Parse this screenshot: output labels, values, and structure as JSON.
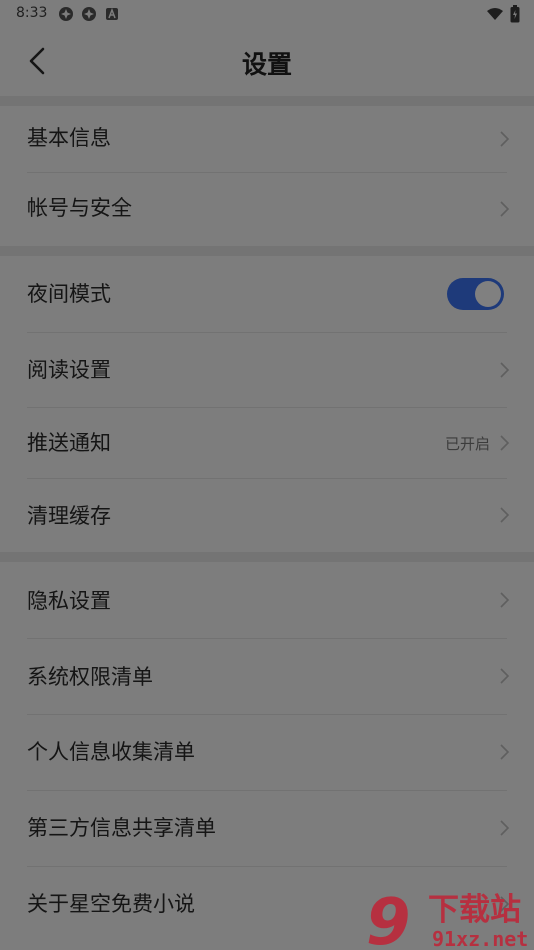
{
  "status": {
    "time": "8:33"
  },
  "header": {
    "title": "设置"
  },
  "group1": [
    {
      "label": "基本信息"
    },
    {
      "label": "帐号与安全"
    }
  ],
  "group2": {
    "night_mode": {
      "label": "夜间模式",
      "enabled": true
    },
    "reading": {
      "label": "阅读设置"
    },
    "push": {
      "label": "推送通知",
      "value": "已开启"
    },
    "cache": {
      "label": "清理缓存"
    }
  },
  "group3": [
    {
      "label": "隐私设置"
    },
    {
      "label": "系统权限清单"
    },
    {
      "label": "个人信息收集清单"
    },
    {
      "label": "第三方信息共享清单"
    },
    {
      "label": "关于星空免费小说"
    }
  ],
  "watermark": {
    "brand": "下载站",
    "domain": "91xz.net",
    "mark": "9"
  },
  "colors": {
    "toggle_on": "#1e3a7a",
    "overlay_bg": "#7a7a7a"
  }
}
